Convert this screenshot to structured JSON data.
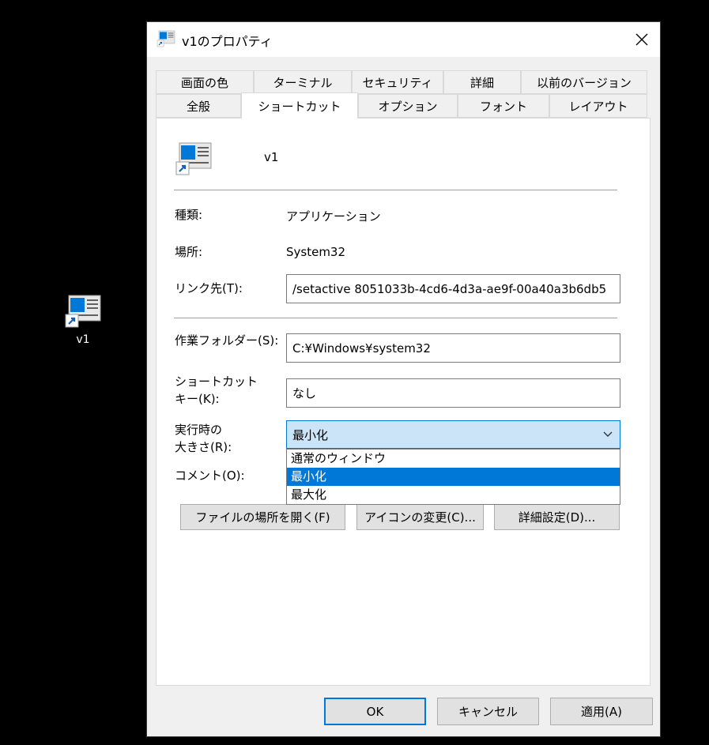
{
  "desktop": {
    "icon_label": "v1"
  },
  "window": {
    "title": "v1のプロパティ"
  },
  "tabs_row1": [
    "画面の色",
    "ターミナル",
    "セキュリティ",
    "詳細",
    "以前のバージョン"
  ],
  "tabs_row2": [
    "全般",
    "ショートカット",
    "オプション",
    "フォント",
    "レイアウト"
  ],
  "active_tab": "ショートカット",
  "shortcut": {
    "name": "v1",
    "type_label": "種類:",
    "type_value": "アプリケーション",
    "location_label": "場所:",
    "location_value": "System32",
    "target_label": "リンク先(T):",
    "target_value": "/setactive 8051033b-4cd6-4d3a-ae9f-00a40a3b6db5",
    "workdir_label": "作業フォルダー(S):",
    "workdir_value": "C:¥Windows¥system32",
    "hotkey_label_1": "ショートカット",
    "hotkey_label_2": "キー(K):",
    "hotkey_value": "なし",
    "run_label_1": "実行時の",
    "run_label_2": "大きさ(R):",
    "run_value": "最小化",
    "run_options": [
      "通常のウィンドウ",
      "最小化",
      "最大化"
    ],
    "comment_label": "コメント(O):",
    "btn_open_location": "ファイルの場所を開く(F)",
    "btn_change_icon": "アイコンの変更(C)...",
    "btn_advanced": "詳細設定(D)..."
  },
  "footer": {
    "ok": "OK",
    "cancel": "キャンセル",
    "apply": "適用(A)"
  },
  "colors": {
    "accent": "#0078d7",
    "selection": "#cce4f7"
  }
}
